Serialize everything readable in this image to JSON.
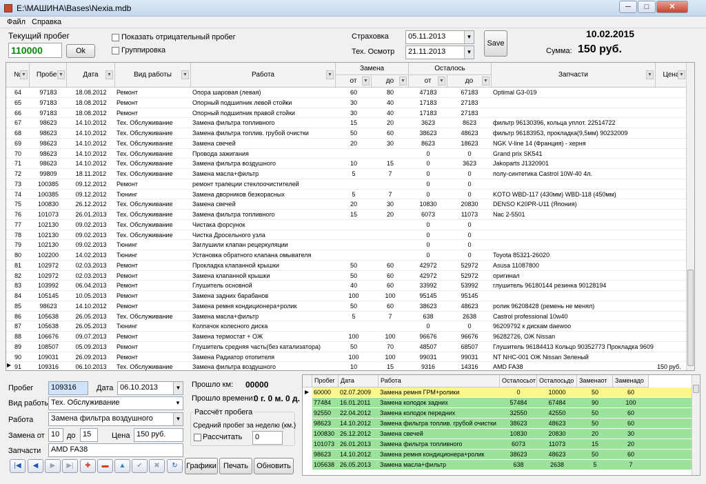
{
  "window": {
    "title": "E:\\МАШИНА\\Bases\\Nexia.mdb",
    "min": "─",
    "max": "□",
    "close": "✕"
  },
  "menu": [
    "Файл",
    "Справка"
  ],
  "top": {
    "mileage_label": "Текущий пробег",
    "mileage_value": "110000",
    "ok_label": "Ok",
    "show_negative_label": "Показать отрицательный пробег",
    "grouping_label": "Группировка",
    "insurance_label": "Страховка",
    "insurance_date": "05.11.2013",
    "inspection_label": "Тех. Осмотр",
    "inspection_date": "21.11.2013",
    "save_label": "Save",
    "current_date": "10.02.2015",
    "sum_label": "Сумма:",
    "sum_value": "150 руб."
  },
  "grid": {
    "headers": {
      "num": "№",
      "mileage": "Пробег",
      "date": "Дата",
      "worktype": "Вид работы",
      "work": "Работа",
      "replace": "Замена",
      "remain": "Осталось",
      "from": "от",
      "to": "до",
      "remfrom": "от",
      "remto": "до",
      "parts": "Запчасти",
      "price": "Цена"
    },
    "rows": [
      [
        "64",
        "97183",
        "18.08.2012",
        "Ремонт",
        "Опора шаровая  (левая)",
        "60",
        "80",
        "47183",
        "67183",
        "Optimal G3-019",
        ""
      ],
      [
        "65",
        "97183",
        "18.08.2012",
        "Ремонт",
        "Опорный подшипник левой стойки",
        "30",
        "40",
        "17183",
        "27183",
        "",
        ""
      ],
      [
        "66",
        "97183",
        "18.08.2012",
        "Ремонт",
        "Опорный подшипник правой стойки",
        "30",
        "40",
        "17183",
        "27183",
        "",
        ""
      ],
      [
        "67",
        "98623",
        "14.10.2012",
        "Тех. Обслуживание",
        "Замена фильтра топливного",
        "15",
        "20",
        "3623",
        "8623",
        "фильтр 96130396, кольца уплот. 22514722",
        ""
      ],
      [
        "68",
        "98623",
        "14.10.2012",
        "Тех. Обслуживание",
        "Замена фильтра топлив. грубой очистки",
        "50",
        "60",
        "38623",
        "48623",
        "фильтр 96183953, прокладка(9,5мм) 90232009",
        ""
      ],
      [
        "69",
        "98623",
        "14.10.2012",
        "Тех. Обслуживание",
        "Замена свечей",
        "20",
        "30",
        "8623",
        "18623",
        "NGK V-line 14 (Франция) - херня",
        ""
      ],
      [
        "70",
        "98623",
        "14.10.2012",
        "Тех. Обслуживание",
        "Провода зажигания",
        "",
        "",
        "0",
        "0",
        "Grand prix SK541",
        ""
      ],
      [
        "71",
        "98623",
        "14.10.2012",
        "Тех. Обслуживание",
        "Замена фильтра воздушного",
        "10",
        "15",
        "0",
        "3623",
        "Jakoparts J1320901",
        ""
      ],
      [
        "72",
        "99809",
        "18.11.2012",
        "Тех. Обслуживание",
        "Замена масла+фильтр",
        "5",
        "7",
        "0",
        "0",
        "полу-синтетика  Castrol 10W-40 4л.",
        ""
      ],
      [
        "73",
        "100385",
        "09.12.2012",
        "Ремонт",
        "ремонт трапеции стеклоочистителей",
        "",
        "",
        "0",
        "0",
        "",
        ""
      ],
      [
        "74",
        "100385",
        "09.12.2012",
        "Тюнинг",
        "Замена дворников безкорасных",
        "5",
        "7",
        "0",
        "0",
        "KOTO WBD-117 (430мм) WBD-118 (450мм)",
        ""
      ],
      [
        "75",
        "100830",
        "26.12.2012",
        "Тех. Обслуживание",
        "Замена свечей",
        "20",
        "30",
        "10830",
        "20830",
        "DENSO K20PR-U11 (Япония)",
        ""
      ],
      [
        "76",
        "101073",
        "26.01.2013",
        "Тех. Обслуживание",
        "Замена фильтра топливного",
        "15",
        "20",
        "6073",
        "11073",
        "Nac 2-5501",
        ""
      ],
      [
        "77",
        "102130",
        "09.02.2013",
        "Тех. Обслуживание",
        "Чистака форсунок",
        "",
        "",
        "0",
        "0",
        "",
        ""
      ],
      [
        "78",
        "102130",
        "09.02.2013",
        "Тех. Обслуживание",
        "Чистка Дросельного узла",
        "",
        "",
        "0",
        "0",
        "",
        ""
      ],
      [
        "79",
        "102130",
        "09.02.2013",
        "Тюнинг",
        "Заглушили клапан рецеркуляции",
        "",
        "",
        "0",
        "0",
        "",
        ""
      ],
      [
        "80",
        "102200",
        "14.02.2013",
        "Тюнинг",
        "Установка обратного клапана омывателя",
        "",
        "",
        "0",
        "0",
        "Toyota 85321-26020",
        ""
      ],
      [
        "81",
        "102972",
        "02.03.2013",
        "Ремонт",
        "Прокладка клапанной крышки",
        "50",
        "60",
        "42972",
        "52972",
        "Asusa 11087800",
        ""
      ],
      [
        "82",
        "102972",
        "02.03.2013",
        "Ремонт",
        "Замена клапанной крышки",
        "50",
        "60",
        "42972",
        "52972",
        "оригинал",
        ""
      ],
      [
        "83",
        "103992",
        "06.04.2013",
        "Ремонт",
        "Глушитель основной",
        "40",
        "60",
        "33992",
        "53992",
        "глушитель 96180144 резинка 90128194",
        ""
      ],
      [
        "84",
        "105145",
        "10.05.2013",
        "Ремонт",
        "Замена задних барабанов",
        "100",
        "100",
        "95145",
        "95145",
        "",
        ""
      ],
      [
        "85",
        "98623",
        "14.10.2012",
        "Ремонт",
        "Замена ремня кондиционера+ролик",
        "50",
        "60",
        "38623",
        "48623",
        "ролик 96208428 (ремень не менял)",
        ""
      ],
      [
        "86",
        "105638",
        "26.05.2013",
        "Тех. Обслуживание",
        "Замена масла+фильтр",
        "5",
        "7",
        "638",
        "2638",
        "Castrol professional 10w40",
        ""
      ],
      [
        "87",
        "105638",
        "26.05.2013",
        "Тюнинг",
        "Колпачок колесного диска",
        "",
        "",
        "0",
        "0",
        "96209792 к дискам daewoo",
        ""
      ],
      [
        "88",
        "106676",
        "09.07.2013",
        "Ремонт",
        "Замена термостат + ОЖ",
        "100",
        "100",
        "96676",
        "96676",
        "96282726, ОЖ Nissan",
        ""
      ],
      [
        "89",
        "108507",
        "05.09.2013",
        "Ремонт",
        "Глушитель средняя часть(без катализатора)",
        "50",
        "70",
        "48507",
        "68507",
        "Глушитель 96184413  Кольцо 90352773 Прокладка 9609",
        ""
      ],
      [
        "90",
        "109031",
        "26.09.2013",
        "Ремонт",
        "Замена Радиатор отопителя",
        "100",
        "100",
        "99031",
        "99031",
        "NT NHC-001     ОЖ Nissan Зеленый",
        ""
      ],
      [
        "91",
        "109316",
        "06.10.2013",
        "Тех. Обслуживание",
        "Замена фильтра воздушного",
        "10",
        "15",
        "9316",
        "14316",
        "AMD FA38",
        "150 руб."
      ]
    ]
  },
  "form": {
    "mileage_label": "Пробег",
    "mileage_value": "109316",
    "date_label": "Дата",
    "date_value": "06.10.2013",
    "worktype_label": "Вид работы",
    "worktype_value": "Тех. Обслуживание",
    "work_label": "Работа",
    "work_value": "Замена фильтра воздушного",
    "replace_from_label": "Замена от",
    "replace_from_value": "10",
    "replace_to_label": "до",
    "replace_to_value": "15",
    "price_label": "Цена",
    "price_value": "150 руб.",
    "parts_label": "Запчасти",
    "parts_value": "AMD FA38"
  },
  "stats": {
    "passed_km_label": "Прошло км:",
    "passed_km_value": "00000",
    "passed_time_label": "Прошло времени:",
    "passed_time_value": "0 г.  0 м.  0 д.",
    "calc_title": "Рассчёт пробега",
    "avg_label": "Средний пробег за неделю (км.)",
    "calc_label": "Рассчитать",
    "calc_value": "0"
  },
  "nav": {
    "first": "|◀",
    "prev": "◀",
    "next": "▶",
    "last": "▶|",
    "add": "✚",
    "delete": "▬",
    "up": "▲",
    "confirm": "✔",
    "cancel": "✖",
    "refresh": "↻",
    "charts_label": "Графики",
    "print_label": "Печать",
    "update_label": "Обновить"
  },
  "reminders": {
    "headers": [
      "Пробег",
      "Дата",
      "Работа",
      "Осталосьот",
      "Осталосьдо",
      "Заменаот",
      "Заменадо"
    ],
    "rows": [
      {
        "cells": [
          "60000",
          "02.07.2009",
          "Замена ремня ГРМ+ролики",
          "0",
          "10000",
          "50",
          "60"
        ],
        "color": "#fbf78a"
      },
      {
        "cells": [
          "77484",
          "16.01.2011",
          "Замена колодок задних",
          "57484",
          "67484",
          "90",
          "100"
        ],
        "color": "#9be39b"
      },
      {
        "cells": [
          "92550",
          "22.04.2012",
          "Замена колодок передних",
          "32550",
          "42550",
          "50",
          "60"
        ],
        "color": "#9be39b"
      },
      {
        "cells": [
          "98623",
          "14.10.2012",
          "Замена фильтра топлив. грубой очистки",
          "38623",
          "48623",
          "50",
          "60"
        ],
        "color": "#9be39b"
      },
      {
        "cells": [
          "100830",
          "26.12.2012",
          "Замена свечей",
          "10830",
          "20830",
          "20",
          "30"
        ],
        "color": "#9be39b"
      },
      {
        "cells": [
          "101073",
          "26.01.2013",
          "Замена фильтра топливного",
          "6073",
          "11073",
          "15",
          "20"
        ],
        "color": "#9be39b"
      },
      {
        "cells": [
          "98623",
          "14.10.2012",
          "Замена ремня кондиционера+ролик",
          "38623",
          "48623",
          "50",
          "60"
        ],
        "color": "#9be39b"
      },
      {
        "cells": [
          "105638",
          "26.05.2013",
          "Замена масла+фильтр",
          "638",
          "2638",
          "5",
          "7"
        ],
        "color": "#9be39b"
      }
    ]
  }
}
